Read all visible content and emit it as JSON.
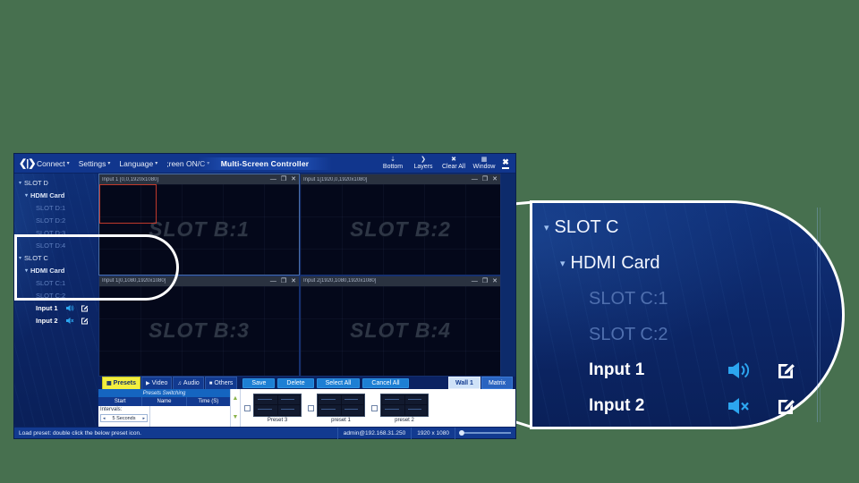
{
  "app": {
    "title": "Multi-Screen Controller",
    "logo_icon": "code-brackets-icon"
  },
  "menubar": {
    "items": [
      {
        "label": "Connect",
        "caret": "▾"
      },
      {
        "label": "Settings",
        "caret": "▾"
      },
      {
        "label": "Language",
        "caret": "▾"
      },
      {
        "label": ";reen ON/C",
        "caret": "▾"
      }
    ],
    "tools": [
      {
        "label": "Bottom",
        "icon": "align-bottom-icon"
      },
      {
        "label": "Layers",
        "icon": "layers-icon"
      },
      {
        "label": "Clear All",
        "icon": "clear-all-icon"
      },
      {
        "label": "Window",
        "icon": "window-icon"
      }
    ],
    "window_controls": {
      "close": "✖",
      "minimize": "minimize-icon"
    }
  },
  "sidebar": {
    "nodes": [
      {
        "level": 0,
        "label": "SLOT D",
        "twisty": "▾",
        "dim": false,
        "icons": false
      },
      {
        "level": 1,
        "label": "HDMI Card",
        "twisty": "▾",
        "dim": false,
        "icons": false
      },
      {
        "level": 2,
        "label": "SLOT D:1",
        "twisty": "",
        "dim": true,
        "icons": false
      },
      {
        "level": 2,
        "label": "SLOT D:2",
        "twisty": "",
        "dim": true,
        "icons": false
      },
      {
        "level": 2,
        "label": "SLOT D:3",
        "twisty": "",
        "dim": true,
        "icons": false
      },
      {
        "level": 2,
        "label": "SLOT D:4",
        "twisty": "",
        "dim": true,
        "icons": false
      },
      {
        "level": 0,
        "label": "SLOT C",
        "twisty": "▾",
        "dim": false,
        "icons": false
      },
      {
        "level": 1,
        "label": "HDMI Card",
        "twisty": "▾",
        "dim": false,
        "icons": false
      },
      {
        "level": 2,
        "label": "SLOT C:1",
        "twisty": "",
        "dim": true,
        "icons": false
      },
      {
        "level": 2,
        "label": "SLOT C:2",
        "twisty": "",
        "dim": true,
        "icons": false
      },
      {
        "level": 3,
        "label": "Input 1",
        "twisty": "",
        "dim": false,
        "icons": true,
        "audio": "on"
      },
      {
        "level": 3,
        "label": "Input 2",
        "twisty": "",
        "dim": false,
        "icons": true,
        "audio": "muted"
      }
    ]
  },
  "wall": {
    "windows": [
      {
        "title": "Input 1 [0,0,1920x1080]",
        "label": "SLOT B:1",
        "selected": true
      },
      {
        "title": "Input 1[1920,0,1920x1080]",
        "label": "SLOT B:2",
        "selected": false
      },
      {
        "title": "Input 1[0,1080,1920x1080]",
        "label": "SLOT B:3",
        "selected": false
      },
      {
        "title": "Input 2[1920,1080,1920x1080]",
        "label": "SLOT B:4",
        "selected": false
      }
    ],
    "window_buttons": {
      "minimize": "—",
      "restore": "❐",
      "close": "✕"
    }
  },
  "toolbar": {
    "tabs": [
      {
        "label": "Presets",
        "icon": "grid-icon",
        "active": true
      },
      {
        "label": "Video",
        "icon": "video-icon",
        "active": false
      },
      {
        "label": "Audio",
        "icon": "audio-icon",
        "active": false
      },
      {
        "label": "Others",
        "icon": "others-icon",
        "active": false
      }
    ],
    "actions": [
      "Save",
      "Delete",
      "Select All",
      "Cancel All"
    ],
    "wall_tabs": [
      {
        "label": "Wall 1",
        "active": true
      },
      {
        "label": "Matrix",
        "active": false
      }
    ]
  },
  "presets_panel": {
    "header": "Presets Switching",
    "columns": [
      "Start",
      "Name",
      "Time (S)"
    ],
    "intervals_label": "Intervals:",
    "interval_value": "5 Seconds",
    "spinner_left": "◂",
    "spinner_right": "▸",
    "arrow_up": "▲",
    "arrow_down": "▼",
    "thumbnails": [
      {
        "caption": "Preset 3",
        "checked": false
      },
      {
        "caption": "preset 1",
        "checked": false
      },
      {
        "caption": "preset 2",
        "checked": false
      }
    ]
  },
  "statusbar": {
    "message": "Load preset: double click the below preset icon.",
    "user": "admin@192.168.31.250",
    "resolution": "1920 x 1080"
  },
  "callout": {
    "nodes": [
      {
        "level": 0,
        "label": "SLOT C",
        "twisty": "▾",
        "dim": false,
        "icons": false
      },
      {
        "level": 1,
        "label": "HDMI Card",
        "twisty": "▾",
        "dim": false,
        "icons": false
      },
      {
        "level": 2,
        "label": "SLOT C:1",
        "twisty": "",
        "dim": true,
        "icons": false
      },
      {
        "level": 2,
        "label": "SLOT C:2",
        "twisty": "",
        "dim": true,
        "icons": false
      },
      {
        "level": 3,
        "label": "Input 1",
        "twisty": "",
        "dim": false,
        "icons": true,
        "audio": "on"
      },
      {
        "level": 3,
        "label": "Input 2",
        "twisty": "",
        "dim": false,
        "icons": true,
        "audio": "muted"
      }
    ]
  },
  "colors": {
    "background": "#47704f",
    "app_blue": "#0d2b6b",
    "menubar_blue": "#11368d",
    "accent_cyan": "#2ca6f0",
    "active_tab_yellow": "#f2ef3f",
    "action_blue": "#1d7fd4",
    "selection_red": "#c0392b",
    "callout_outline": "#ffffff"
  }
}
